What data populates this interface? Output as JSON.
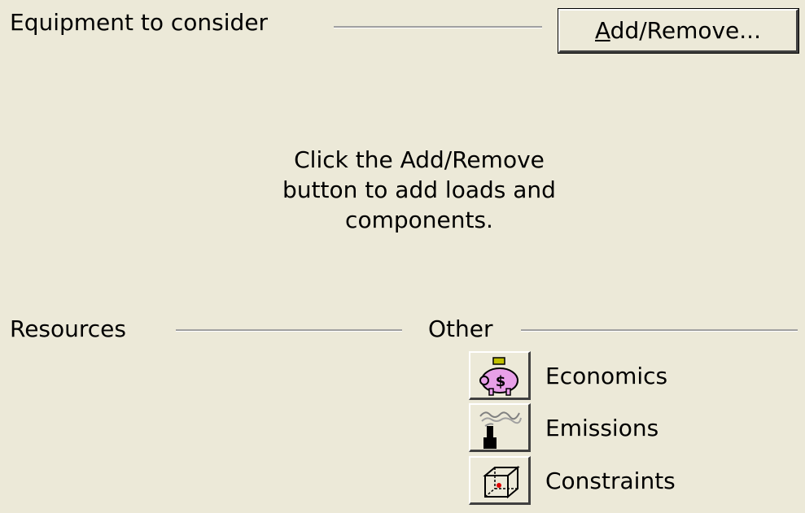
{
  "equipment": {
    "section_label": "Equipment to consider",
    "add_remove_button": {
      "accel": "A",
      "rest": "dd/Remove..."
    },
    "hint_lines": [
      "Click the Add/Remove",
      "button to add loads and",
      "components."
    ]
  },
  "resources": {
    "section_label": "Resources"
  },
  "other": {
    "section_label": "Other",
    "items": [
      {
        "label": "Economics",
        "icon": "piggy-bank-dollar-icon"
      },
      {
        "label": "Emissions",
        "icon": "smokestack-icon"
      },
      {
        "label": "Constraints",
        "icon": "constraint-box-icon"
      }
    ]
  }
}
